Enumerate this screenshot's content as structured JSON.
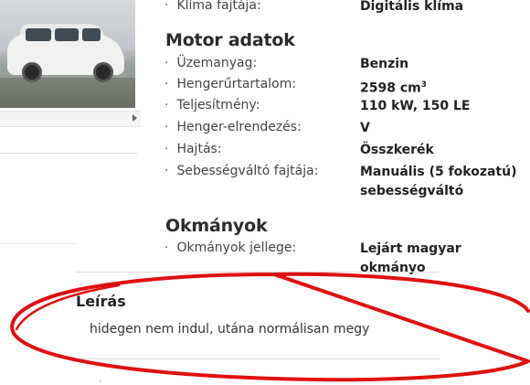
{
  "top_row": {
    "label": "Klíma fajtája:",
    "value": "Digitális klíma"
  },
  "motor": {
    "title": "Motor adatok",
    "rows": [
      {
        "label": "Üzemanyag:",
        "value": "Benzin"
      },
      {
        "label": "Hengerűrtartalom:",
        "value": "2598 cm",
        "sup": "3"
      },
      {
        "label": "Teljesítmény:",
        "value": "110 kW, 150 LE"
      },
      {
        "label": "Henger-elrendezés:",
        "value": "V"
      },
      {
        "label": "Hajtás:",
        "value": "Összkerék"
      },
      {
        "label": "Sebességváltó fajtája:",
        "value_line1": "Manuális (5 fokozatú)",
        "value_line2": "sebességváltó"
      }
    ]
  },
  "okmanyok": {
    "title": "Okmányok",
    "rows": [
      {
        "label": "Okmányok jellege:",
        "value": "Lejárt magyar okmányo"
      }
    ]
  },
  "description": {
    "title": "Leírás",
    "text": "hidegen nem indul, utána normálisan megy"
  },
  "bullet": "·",
  "annotation_color": "#e01010",
  "icons": {
    "scroll": "triangle-right",
    "photo": "car-photo"
  }
}
